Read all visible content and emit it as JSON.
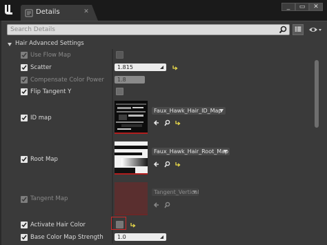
{
  "window": {
    "tab_title": "Details",
    "tab_icon": "details-icon",
    "app_icon": "unreal-logo-icon"
  },
  "search": {
    "placeholder": "Search Details",
    "value": ""
  },
  "category": {
    "label": "Hair Advanced Settings",
    "expanded": true
  },
  "properties": [
    {
      "key": "use_flow_map",
      "label": "Use Flow Map",
      "enabled": false,
      "checked": true,
      "type": "bool",
      "value": false
    },
    {
      "key": "scatter",
      "label": "Scatter",
      "enabled": true,
      "checked": true,
      "type": "float",
      "value": "1.815",
      "resettable": true
    },
    {
      "key": "compensate_color_power",
      "label": "Compensate Color Power",
      "enabled": false,
      "checked": true,
      "type": "float",
      "value": "1.8"
    },
    {
      "key": "flip_tangent_y",
      "label": "Flip Tangent Y",
      "enabled": true,
      "checked": true,
      "type": "bool",
      "value": false
    },
    {
      "key": "id_map",
      "label": "ID map",
      "enabled": true,
      "checked": true,
      "type": "texture",
      "asset": "Faux_Hawk_Hair_ID_Map",
      "resettable": true
    },
    {
      "key": "root_map",
      "label": "Root Map",
      "enabled": true,
      "checked": true,
      "type": "texture",
      "asset": "Faux_Hawk_Hair_Root_Map",
      "resettable": true
    },
    {
      "key": "tangent_map",
      "label": "Tangent Map",
      "enabled": false,
      "checked": true,
      "type": "texture",
      "asset": "Tangent_Vertical"
    },
    {
      "key": "activate_hair_color",
      "label": "Activate Hair Color",
      "enabled": true,
      "checked": true,
      "type": "bool",
      "value": false,
      "resettable": true
    },
    {
      "key": "base_color_map_strength",
      "label": "Base Color Map Strength",
      "enabled": true,
      "checked": true,
      "type": "float",
      "value": "1.0"
    }
  ],
  "colors": {
    "accent_reset": "#e8d84a",
    "highlight": "#d12a2a",
    "thumb_bar": "#b21e1e"
  }
}
